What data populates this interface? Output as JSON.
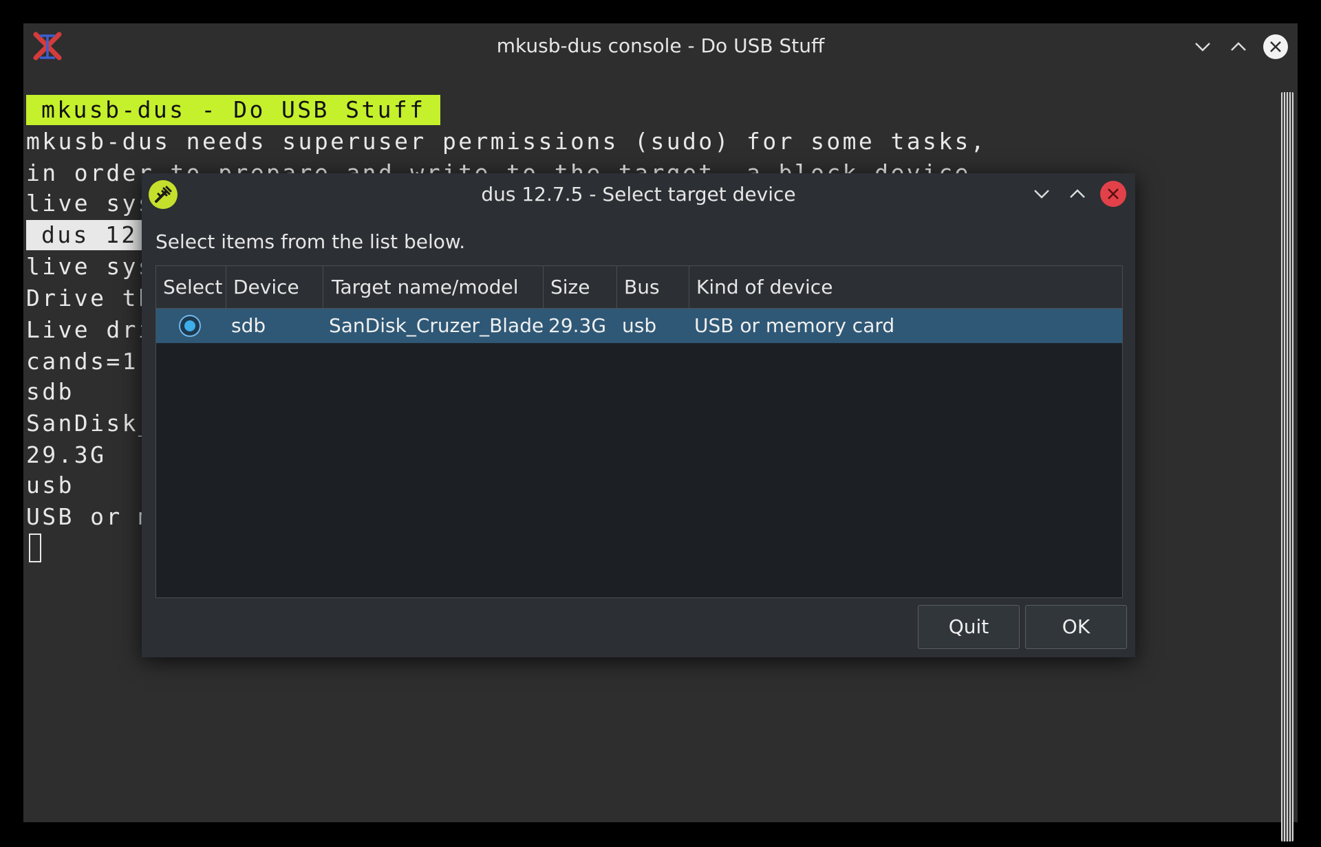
{
  "terminal": {
    "title": "mkusb-dus console - Do USB Stuff",
    "banner": "mkusb-dus - Do USB Stuff",
    "lines": [
      "mkusb-dus needs superuser permissions (sudo) for some tasks,",
      "in order to prepare and write to the target, a block device.",
      "live sys",
      "dus 12",
      "live sys",
      "Drive th",
      "Live dri",
      "cands=1",
      "sdb",
      "SanDisk_",
      "29.3G",
      "usb",
      "USB or m"
    ]
  },
  "dialog": {
    "title": "dus 12.7.5 - Select target device",
    "prompt": "Select items from the list below.",
    "columns": [
      "Select",
      "Device",
      "Target name/model",
      "Size",
      "Bus",
      "Kind of device"
    ],
    "rows": [
      {
        "selected": true,
        "device": "sdb",
        "target": "SanDisk_Cruzer_Blade",
        "size": "29.3G",
        "bus": "usb",
        "kind": "USB or memory card"
      }
    ],
    "buttons": {
      "quit": "Quit",
      "ok": "OK"
    }
  },
  "colors": {
    "terminal_bg": "#2e2e2e",
    "banner_bg": "#c5f02c",
    "selected_row": "#2f5876",
    "close_button_red": "#e2414a",
    "accent_blue": "#3daee9"
  },
  "icons": {
    "terminal_app": "x-logo-icon",
    "dialog_app": "usb-tool-icon"
  }
}
